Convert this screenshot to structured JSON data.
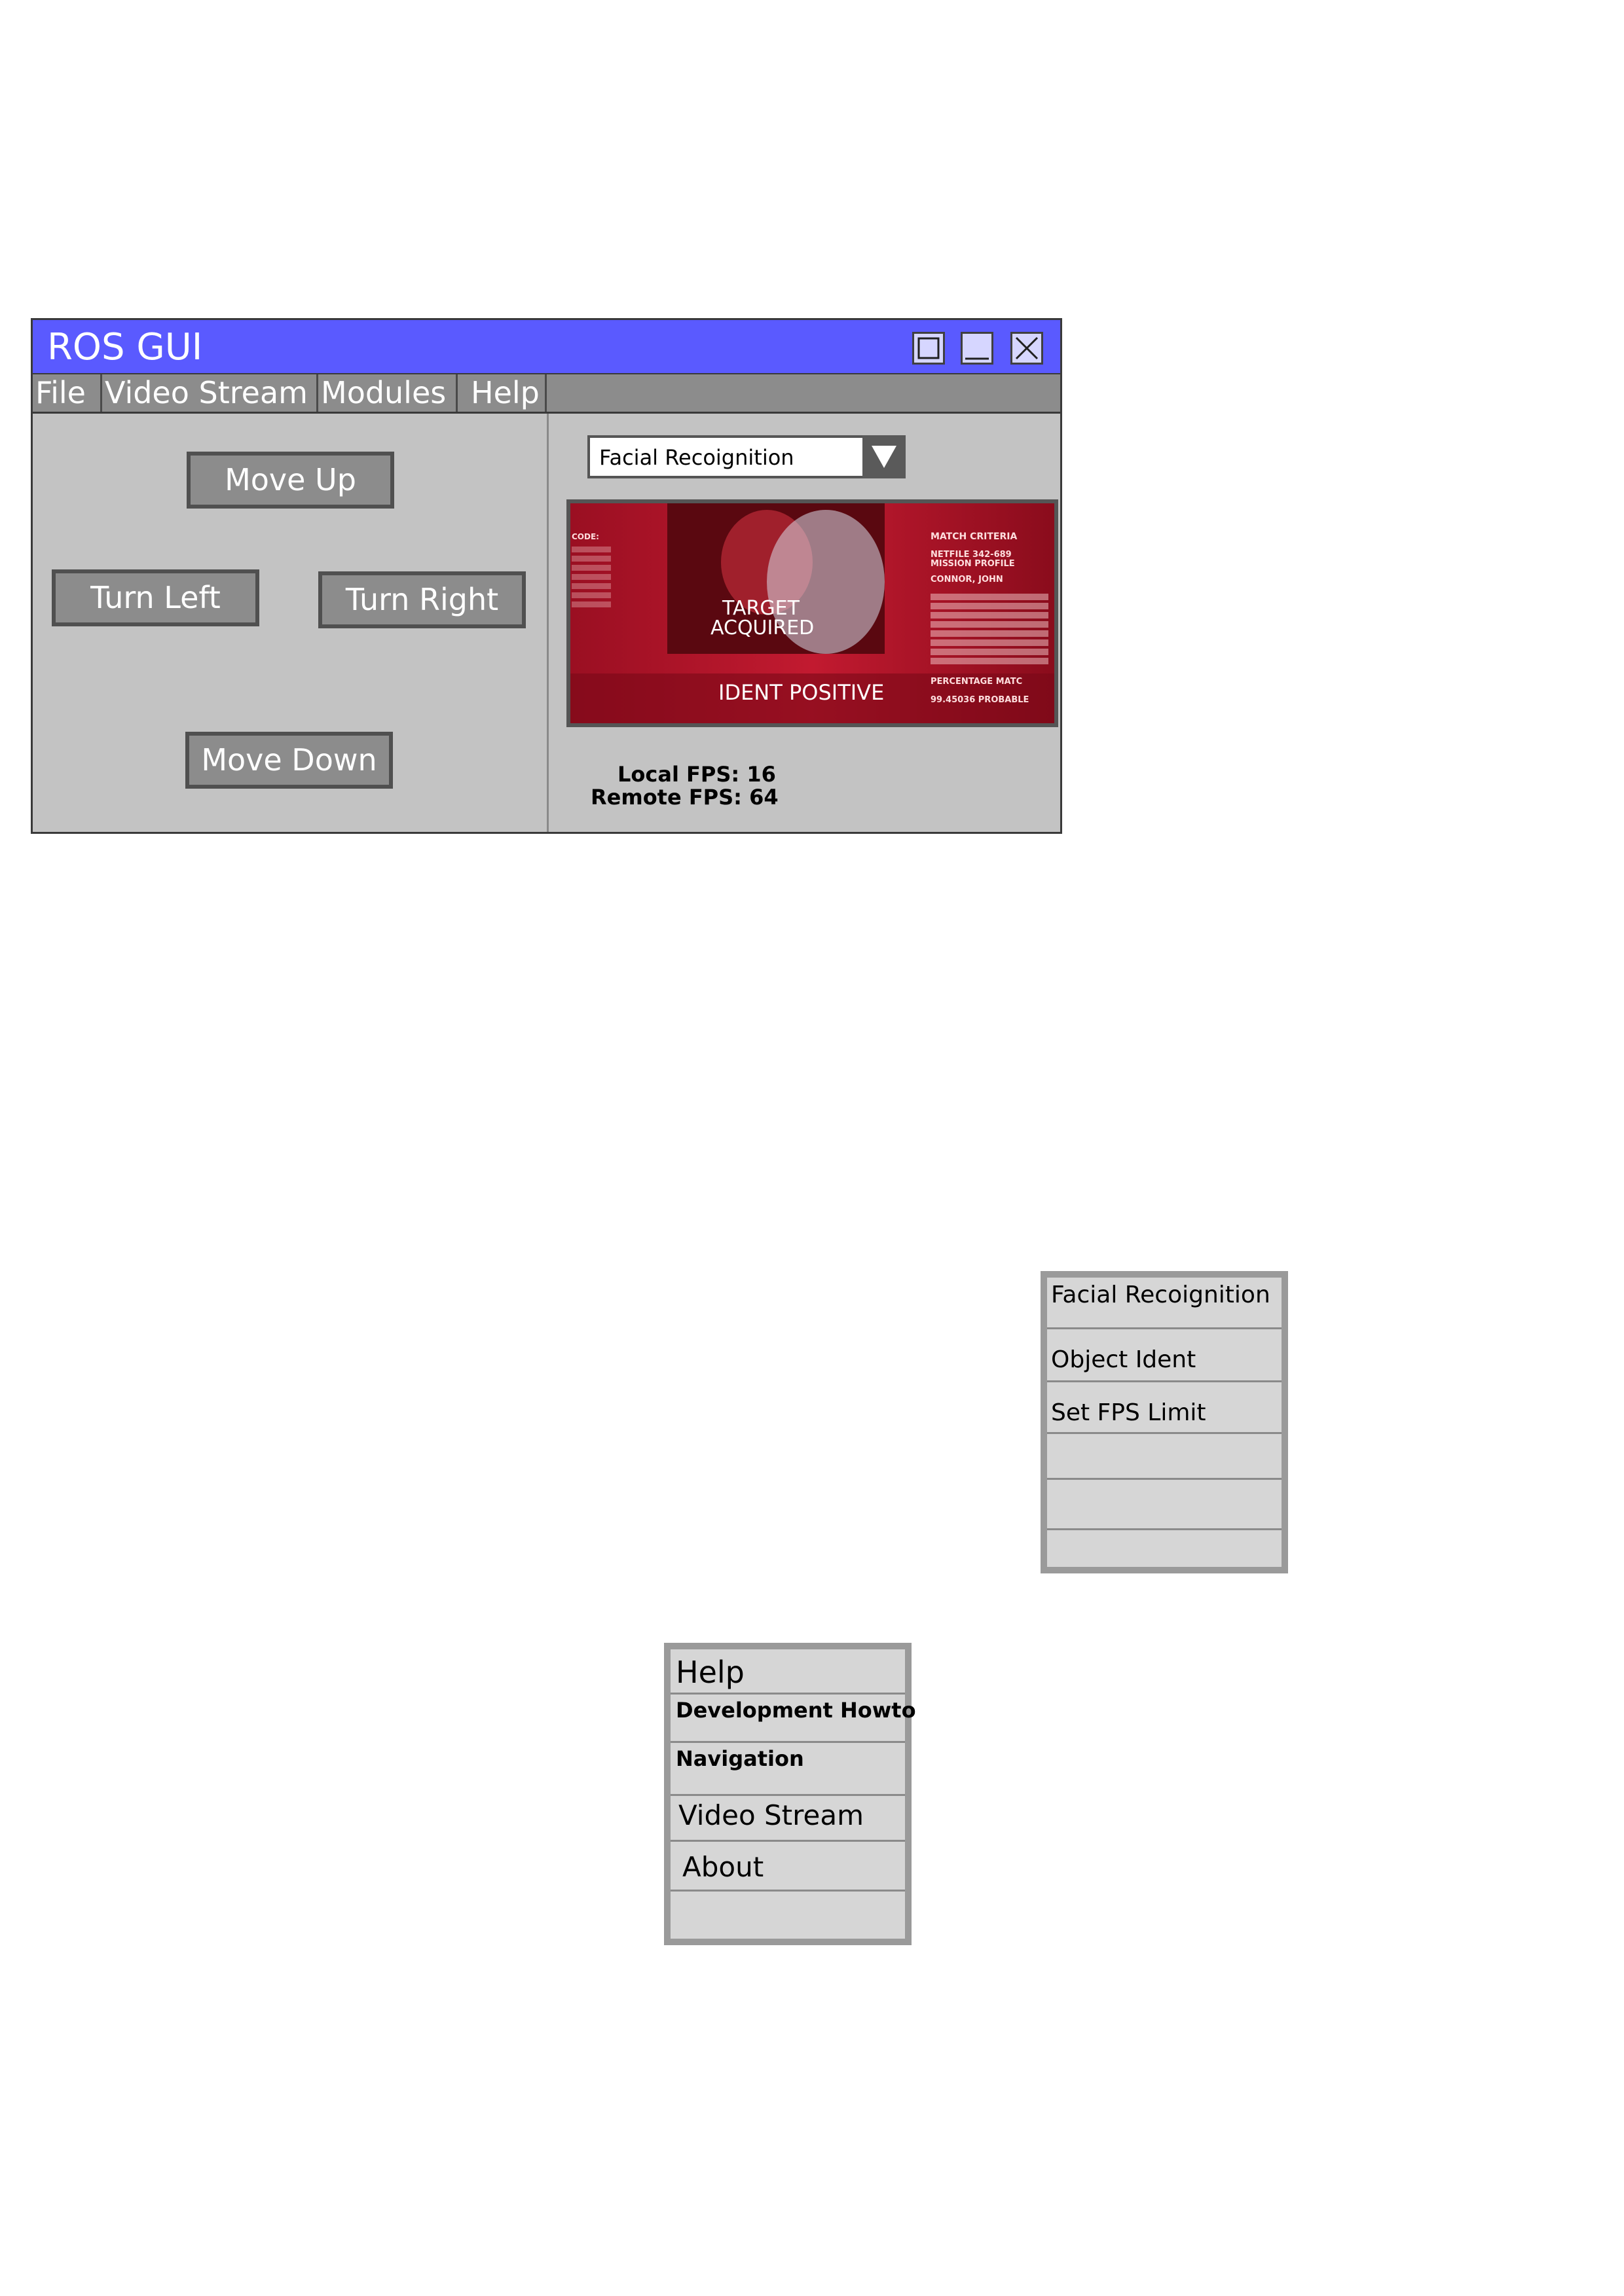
{
  "window": {
    "title": "ROS GUI",
    "controls": [
      "maximize-icon",
      "minimize-icon",
      "close-icon"
    ]
  },
  "menu": {
    "file": "File",
    "video_stream": "Video Stream",
    "modules": "Modules",
    "help": "Help"
  },
  "controls": {
    "move_up": "Move Up",
    "turn_left": "Turn Left",
    "turn_right": "Turn Right",
    "move_down": "Move Down"
  },
  "module_select": {
    "selected": "Facial Recoignition"
  },
  "video": {
    "overlay_lines": {
      "code": "CODE:",
      "match_criteria": "MATCH CRITERIA",
      "netfile": "NETFILE 342-689",
      "mission_profile": "MISSION PROFILE",
      "name": "CONNOR, JOHN",
      "target": "TARGET",
      "acquired": "ACQUIRED",
      "ident": "IDENT POSITIVE",
      "percentage": "PERCENTAGE MATC",
      "probable": "99.45036 PROBABLE"
    }
  },
  "fps": {
    "local": "Local FPS: 16",
    "remote": "Remote FPS: 64"
  },
  "modules_menu": {
    "items": [
      "Facial Recoignition",
      "Object Ident",
      "Set FPS Limit",
      "",
      "",
      ""
    ]
  },
  "help_menu": {
    "items": [
      "Help",
      "Development Howto",
      "Navigation",
      "Video Stream",
      "About",
      ""
    ]
  },
  "colors": {
    "titlebar": "#5a5aff",
    "window_bg": "#c3c3c3",
    "button_bg": "#8c8c8c",
    "menu_bg": "#8c8c8c",
    "video_bg": "#8a0a1a"
  }
}
